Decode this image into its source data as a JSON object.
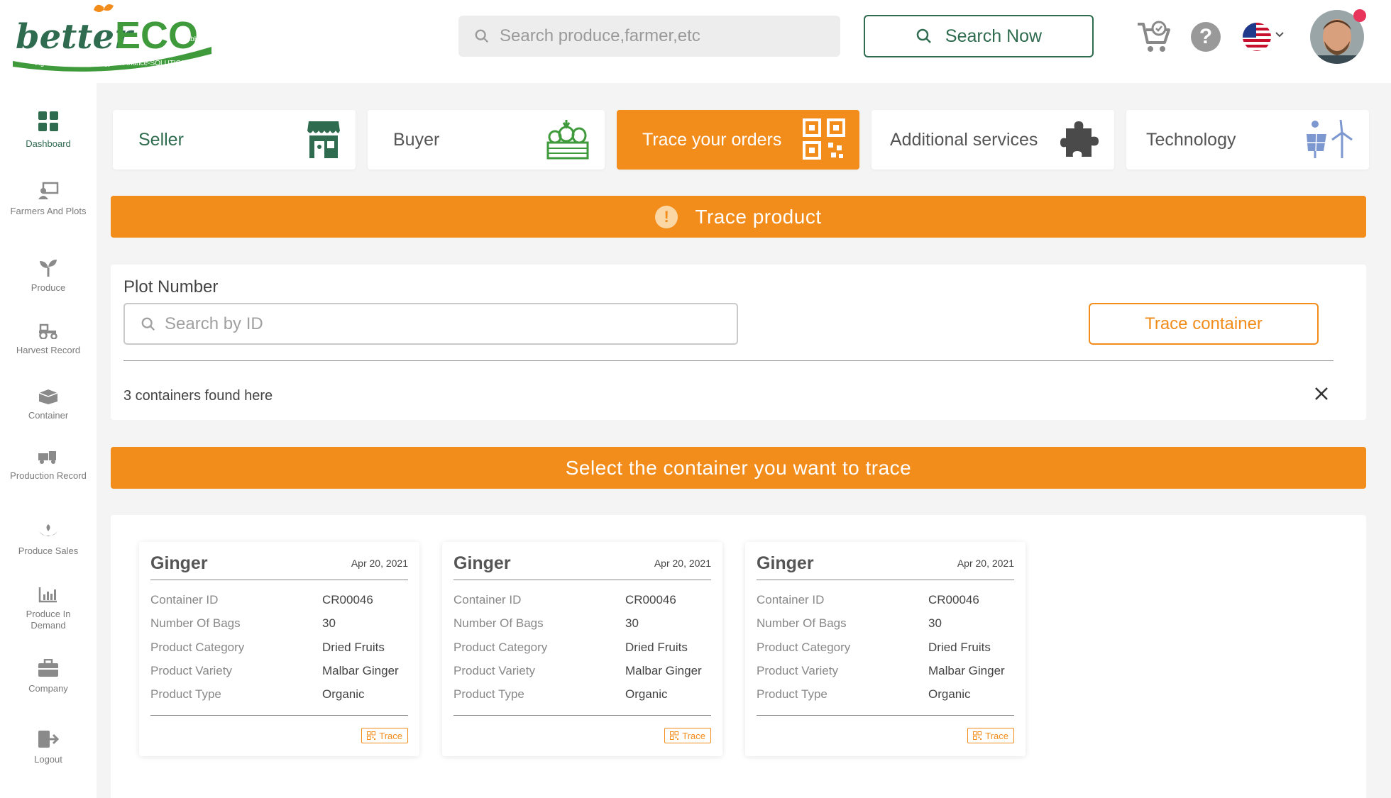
{
  "brand": {
    "name_part1": "better",
    "name_part2": "ECO",
    "suffix": "GmbH",
    "tagline": "Agriculture-, Technology- & Finance-SOLUTIONS."
  },
  "header": {
    "search_placeholder": "Search produce,farmer,etc",
    "search_button": "Search Now",
    "icons": [
      "cart-icon",
      "help-icon",
      "us-flag-icon",
      "chevron-down-icon",
      "avatar"
    ],
    "help_glyph": "?"
  },
  "sidebar": {
    "items": [
      {
        "label": "Dashboard",
        "icon": "dashboard-icon",
        "active": true
      },
      {
        "label": "Farmers And Plots",
        "icon": "farmers-icon"
      },
      {
        "label": "Produce",
        "icon": "sprout-icon"
      },
      {
        "label": "Harvest Record",
        "icon": "tractor-icon"
      },
      {
        "label": "Container",
        "icon": "container-icon"
      },
      {
        "label": "Production Record",
        "icon": "truck-icon"
      },
      {
        "label": "Produce Sales",
        "icon": "sales-icon"
      },
      {
        "label": "Produce In Demand",
        "icon": "bar-chart-icon"
      },
      {
        "label": "Company",
        "icon": "briefcase-icon"
      },
      {
        "label": "Logout",
        "icon": "logout-icon"
      }
    ]
  },
  "tabs": [
    {
      "label": "Seller",
      "icon": "store-icon"
    },
    {
      "label": "Buyer",
      "icon": "vegetables-icon"
    },
    {
      "label": "Trace your orders",
      "icon": "qr-code-icon",
      "active": true
    },
    {
      "label": "Additional services",
      "icon": "puzzle-icon"
    },
    {
      "label": "Technology",
      "icon": "solar-wind-icon"
    }
  ],
  "trace_banner": {
    "icon": "alert-icon",
    "glyph": "!",
    "title": "Trace product"
  },
  "plot": {
    "label": "Plot Number",
    "placeholder": "Search by ID",
    "trace_button": "Trace container",
    "result_text": "3 containers found here"
  },
  "select_banner": "Select the container you want to trace",
  "colors": {
    "accent": "#f28c1b",
    "brand_green": "#2f6b4f",
    "background": "#f4f4f4"
  },
  "containers": [
    {
      "title": "Ginger",
      "date": "Apr 20, 2021",
      "rows": [
        {
          "k": "Container ID",
          "v": "CR00046"
        },
        {
          "k": "Number Of Bags",
          "v": "30"
        },
        {
          "k": "Product Category",
          "v": "Dried Fruits"
        },
        {
          "k": "Product Variety",
          "v": "Malbar Ginger"
        },
        {
          "k": "Product Type",
          "v": "Organic"
        }
      ],
      "trace": "Trace"
    },
    {
      "title": "Ginger",
      "date": "Apr 20, 2021",
      "rows": [
        {
          "k": "Container ID",
          "v": "CR00046"
        },
        {
          "k": "Number Of Bags",
          "v": "30"
        },
        {
          "k": "Product Category",
          "v": "Dried Fruits"
        },
        {
          "k": "Product Variety",
          "v": "Malbar Ginger"
        },
        {
          "k": "Product Type",
          "v": "Organic"
        }
      ],
      "trace": "Trace"
    },
    {
      "title": "Ginger",
      "date": "Apr 20, 2021",
      "rows": [
        {
          "k": "Container ID",
          "v": "CR00046"
        },
        {
          "k": "Number Of Bags",
          "v": "30"
        },
        {
          "k": "Product Category",
          "v": "Dried Fruits"
        },
        {
          "k": "Product Variety",
          "v": "Malbar Ginger"
        },
        {
          "k": "Product Type",
          "v": "Organic"
        }
      ],
      "trace": "Trace"
    }
  ]
}
